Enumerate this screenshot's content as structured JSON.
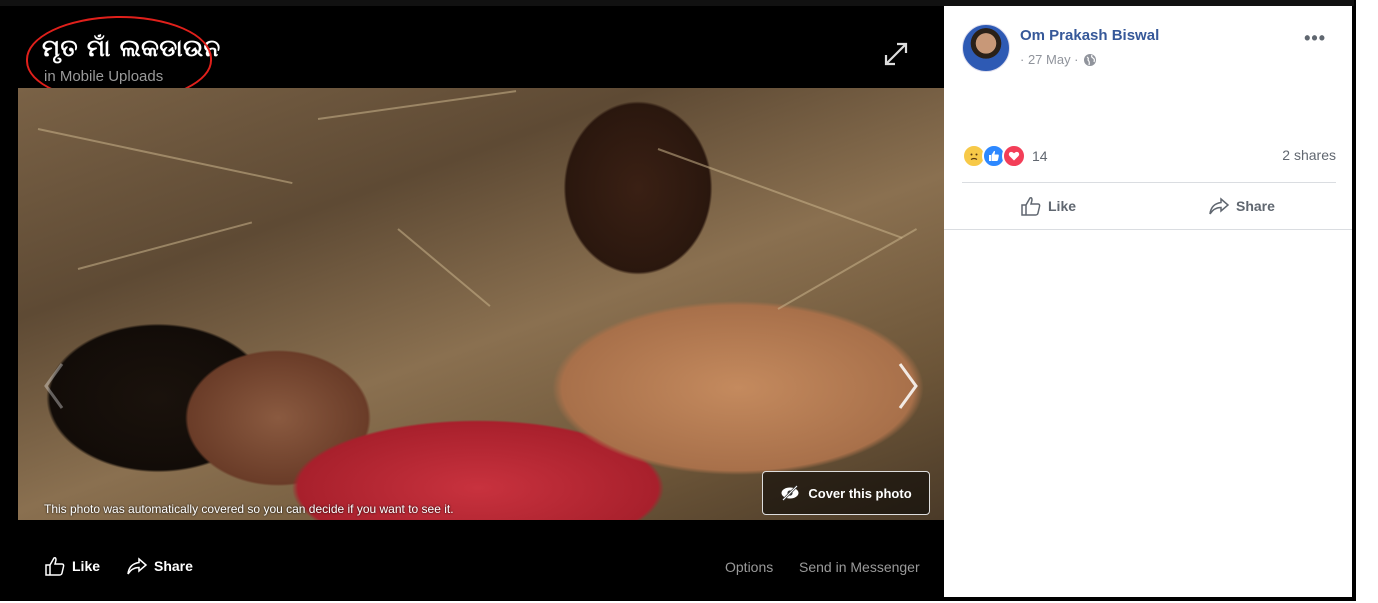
{
  "viewer": {
    "title": "ମୃତ ମାଁ ଲକଡାଉନ",
    "album": "in Mobile Uploads",
    "cover_caption": "This photo was automatically covered so you can decide if you want to see it.",
    "cover_button_label": "Cover this photo",
    "footer": {
      "like_label": "Like",
      "share_label": "Share",
      "options_label": "Options",
      "send_label": "Send in Messenger"
    }
  },
  "post": {
    "author": "Om Prakash Biswal",
    "date": "· 27 May ·",
    "privacy_icon": "globe-icon",
    "reactions": [
      "sad",
      "like",
      "love"
    ],
    "reaction_count": "14",
    "shares": "2 shares",
    "like_label": "Like",
    "share_label": "Share"
  },
  "colors": {
    "link_blue": "#365899",
    "annotation_red": "#e0201b",
    "like_blue": "#2d88ff",
    "love_red": "#f33e58"
  }
}
